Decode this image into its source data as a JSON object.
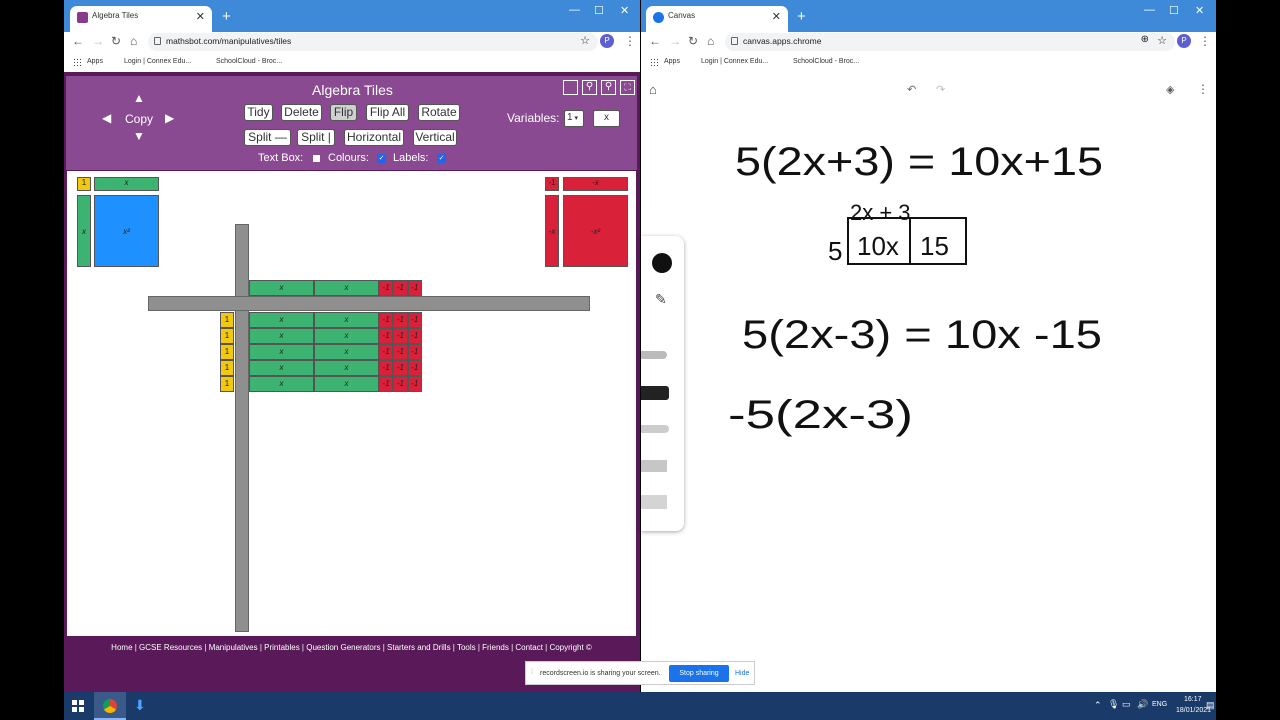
{
  "left_window": {
    "tab_title": "Algebra Tiles",
    "url": "mathsbot.com/manipulatives/tiles",
    "bookmarks": [
      "Apps",
      "Login | Connex Edu...",
      "SchoolCloud - Broc..."
    ],
    "avatar": "P"
  },
  "algebra_tiles": {
    "title": "Algebra Tiles",
    "copy_label": "Copy",
    "buttons": {
      "tidy": "Tidy",
      "delete": "Delete",
      "flip": "Flip",
      "flip_all": "Flip All",
      "rotate": "Rotate",
      "split_h": "Split —",
      "split_v": "Split |",
      "horizontal": "Horizontal",
      "vertical": "Vertical"
    },
    "variables_label": "Variables:",
    "variables_value": "1",
    "variable_name": "x",
    "text_box_label": "Text Box:",
    "colours_label": "Colours:",
    "labels_label": "Labels:",
    "palette": {
      "one": "1",
      "x": "x",
      "x2": "x²",
      "neg_one": "-1",
      "neg_x": "-x",
      "neg_x2": "-x²"
    },
    "grid": {
      "cell_x": "x",
      "cell_one": "1",
      "cell_neg": "-1"
    },
    "footer": "Home | GCSE Resources | Manipulatives | Printables | Question Generators | Starters and Drills | Tools | Friends | Contact | Copyright ©",
    "colors": {
      "positive": "#3cb371",
      "negative": "#d9213a",
      "unit": "#f2c811",
      "square": "#1e90ff",
      "toolbar": "#8a4a92"
    }
  },
  "right_window": {
    "tab_title": "Canvas",
    "url": "canvas.apps.chrome",
    "bookmarks": [
      "Apps",
      "Login | Connex Edu...",
      "SchoolCloud - Broc..."
    ],
    "avatar": "P"
  },
  "handwriting": {
    "line1": "5(2x+3) = 10x+15",
    "grid_top": "2x + 3",
    "grid_left": "5",
    "grid_cell1": "10x",
    "grid_cell2": "15",
    "line2": "5(2x-3) = 10x -15",
    "line3": "-5(2x-3)"
  },
  "share_bar": {
    "text": "recordscreen.io is sharing your screen.",
    "stop": "Stop sharing",
    "hide": "Hide"
  },
  "taskbar": {
    "lang": "ENG",
    "time": "16:17",
    "date": "18/01/2021"
  }
}
